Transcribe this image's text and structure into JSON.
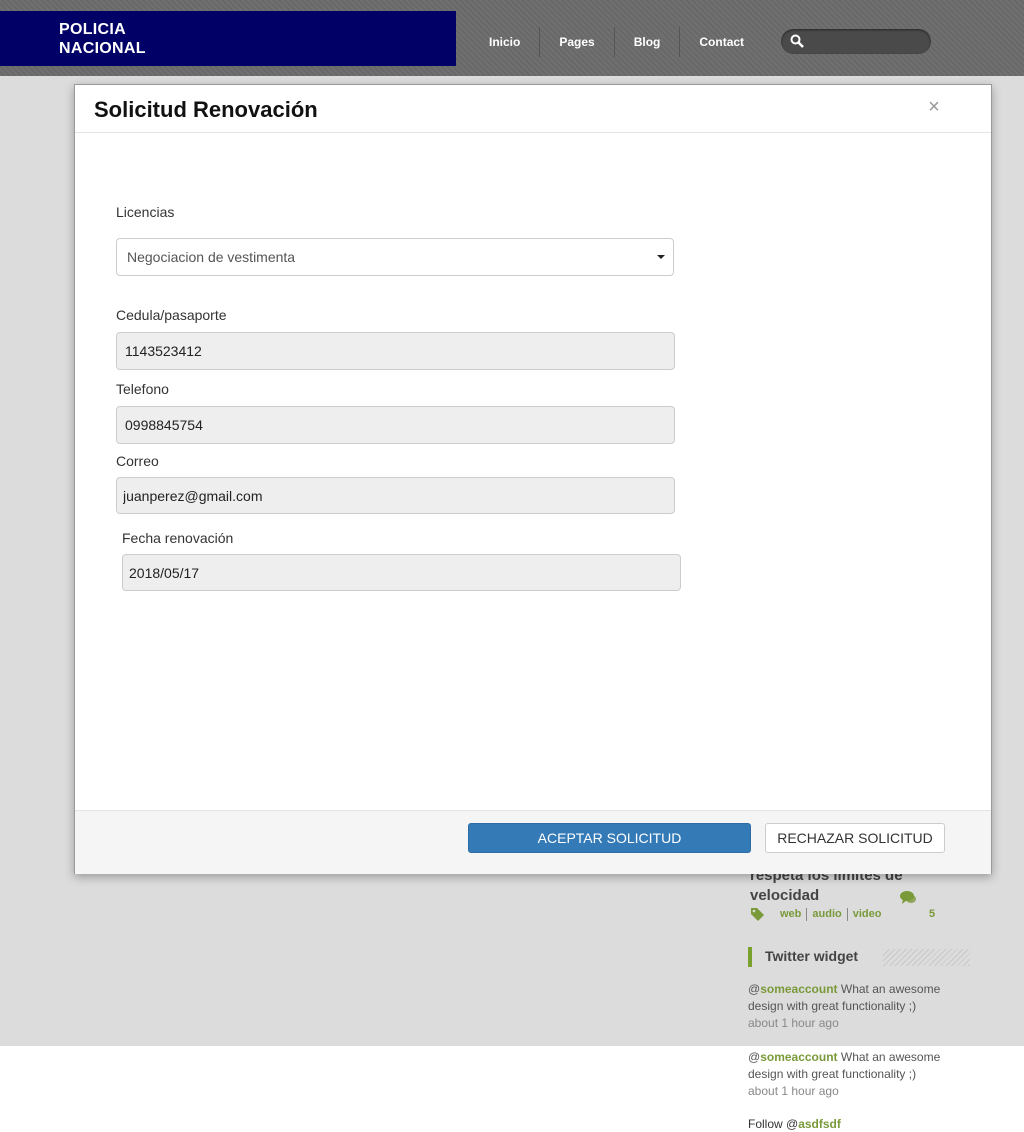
{
  "header": {
    "logo_line1": "POLICIA",
    "logo_line2": "NACIONAL",
    "nav": [
      "Inicio",
      "Pages",
      "Blog",
      "Contact"
    ],
    "search_placeholder": ""
  },
  "sidebar": {
    "post_title": "respeta los limites de velocidad",
    "tags": [
      "web",
      "audio",
      "video"
    ],
    "comment_count": "5",
    "widget_title": "Twitter widget",
    "tweets": [
      {
        "at": "@",
        "account": "someaccount",
        "text": " What an awesome design with great functionality ;)",
        "time": "about 1 hour ago"
      },
      {
        "at": "@",
        "account": "someaccount",
        "text": " What an awesome design with great functionality ;)",
        "time": "about 1 hour ago"
      }
    ],
    "follow_prefix": "Follow @",
    "follow_account": "asdfsdf"
  },
  "modal": {
    "title": "Solicitud Renovación",
    "close": "×",
    "licencias_label": "Licencias",
    "licencias_value": "Negociacion de vestimenta",
    "cedula_label": "Cedula/pasaporte",
    "cedula_value": "1143523412",
    "telefono_label": "Telefono",
    "telefono_value": "0998845754",
    "correo_label": "Correo",
    "correo_value": "juanperez@gmail.com",
    "fecha_label": "Fecha renovación",
    "fecha_value": "2018/05/17",
    "accept_label": "ACEPTAR SOLICITUD",
    "reject_label": "RECHAZAR SOLICITUD"
  },
  "colors": {
    "logo_bg": "#000066",
    "accent_green": "#7a9a3a",
    "primary_button": "#337ab7"
  }
}
